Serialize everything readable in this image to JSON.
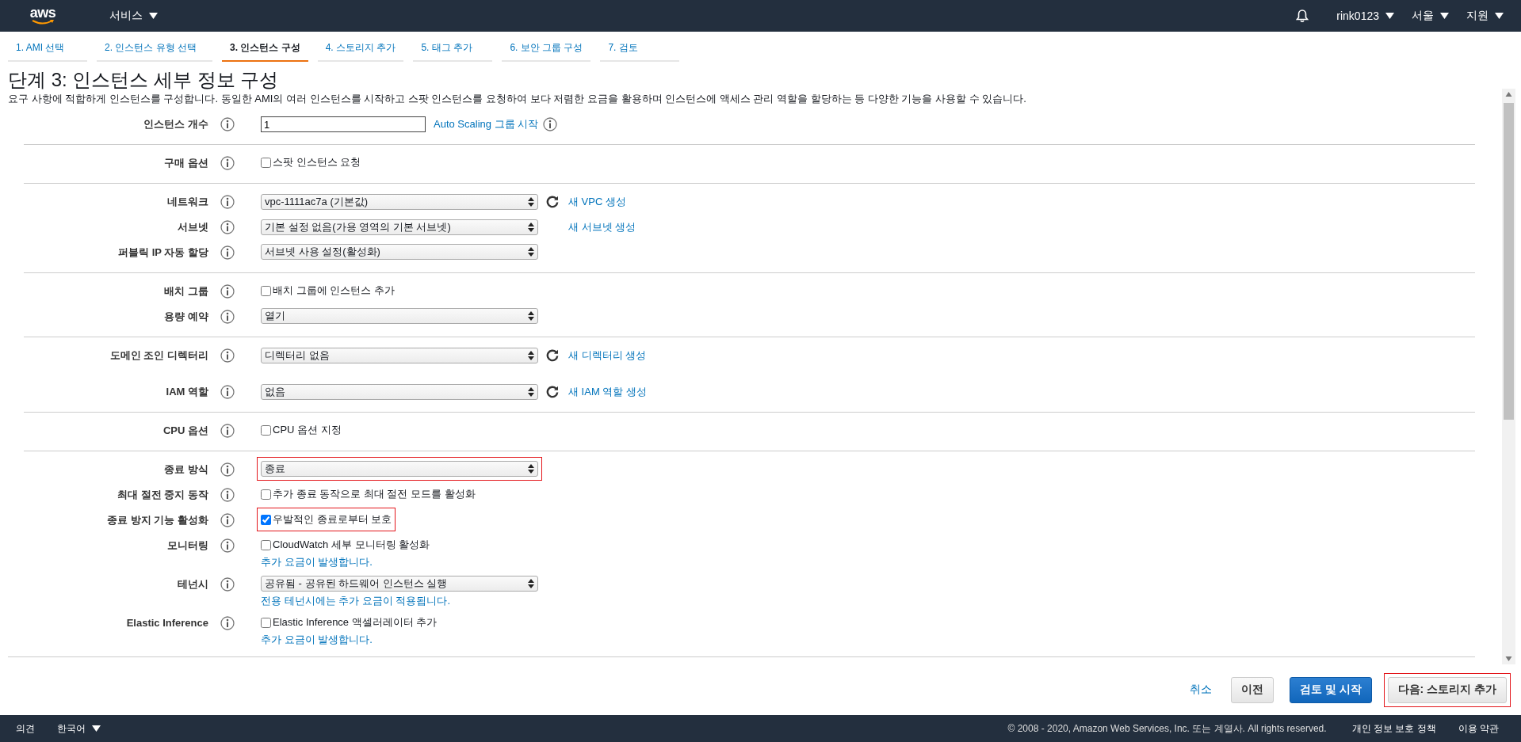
{
  "topbar": {
    "logo": "aws",
    "services": "서비스",
    "user": "rink0123",
    "region": "서울",
    "support": "지원"
  },
  "tabs": [
    {
      "label": "1. AMI 선택",
      "selected": false
    },
    {
      "label": "2. 인스턴스 유형 선택",
      "selected": false
    },
    {
      "label": "3. 인스턴스 구성",
      "selected": true
    },
    {
      "label": "4. 스토리지 추가",
      "selected": false
    },
    {
      "label": "5. 태그 추가",
      "selected": false
    },
    {
      "label": "6. 보안 그룹 구성",
      "selected": false
    },
    {
      "label": "7. 검토",
      "selected": false
    }
  ],
  "title": "단계 3: 인스턴스 세부 정보 구성",
  "description": "요구 사항에 적합하게 인스턴스를 구성합니다. 동일한 AMI의 여러 인스턴스를 시작하고 스팟 인스턴스를 요청하여 보다 저렴한 요금을 활용하며 인스턴스에 액세스 관리 역할을 할당하는 등 다양한 기능을 사용할 수 있습니다.",
  "sections": [
    {
      "rows": [
        {
          "label": "인스턴스 개수",
          "control": {
            "kind": "text",
            "value": "1"
          },
          "link": {
            "text": "Auto Scaling 그룹 시작",
            "refresh": false,
            "info": true
          }
        }
      ]
    },
    {
      "rows": [
        {
          "label": "구매 옵션",
          "control": {
            "kind": "checkbox",
            "text": "스팟 인스턴스 요청",
            "checked": false
          }
        }
      ]
    },
    {
      "rows": [
        {
          "label": "네트워크",
          "control": {
            "kind": "select",
            "value": "vpc-1111ac7a (기본값)"
          },
          "link": {
            "text": "새 VPC 생성",
            "refresh": true,
            "info": false
          }
        },
        {
          "label": "서브넷",
          "control": {
            "kind": "select",
            "value": "기본 설정 없음(가용 영역의 기본 서브넷)"
          },
          "link": {
            "text": "새 서브넷 생성",
            "refresh": false,
            "info": false
          }
        },
        {
          "label": "퍼블릭 IP 자동 할당",
          "control": {
            "kind": "select",
            "value": "서브넷 사용 설정(활성화)"
          }
        }
      ]
    },
    {
      "rows": [
        {
          "label": "배치 그룹",
          "control": {
            "kind": "checkbox",
            "text": "배치 그룹에 인스턴스 추가",
            "checked": false
          }
        },
        {
          "label": "용량 예약",
          "control": {
            "kind": "select",
            "value": "열기"
          }
        }
      ]
    },
    {
      "rows": [
        {
          "label": "도메인 조인 디렉터리",
          "control": {
            "kind": "select",
            "value": "디렉터리 없음"
          },
          "link": {
            "text": "새 디렉터리 생성",
            "refresh": true,
            "info": false
          }
        },
        {
          "label": "IAM 역할",
          "control": {
            "kind": "select",
            "value": "없음"
          },
          "link": {
            "text": "새 IAM 역할 생성",
            "refresh": true,
            "info": false
          }
        }
      ]
    },
    {
      "rows": [
        {
          "label": "CPU 옵션",
          "control": {
            "kind": "checkbox",
            "text": "CPU 옵션 지정",
            "checked": false
          }
        }
      ]
    },
    {
      "rows": [
        {
          "label": "종료 방식",
          "control": {
            "kind": "select",
            "value": "종료",
            "highlighted": true
          }
        },
        {
          "label": "최대 절전 중지 동작",
          "control": {
            "kind": "checkbox",
            "text": "추가 종료 동작으로 최대 절전 모드를 활성화",
            "checked": false
          }
        },
        {
          "label": "종료 방지 기능 활성화",
          "control": {
            "kind": "checkbox",
            "text": "우발적인 종료로부터 보호",
            "checked": true,
            "highlighted": true
          }
        },
        {
          "label": "모니터링",
          "control": {
            "kind": "checkbox",
            "text": "CloudWatch 세부 모니터링 활성화",
            "checked": false
          },
          "note": "추가 요금이 발생합니다."
        },
        {
          "label": "테넌시",
          "control": {
            "kind": "select",
            "value": "공유됨 - 공유된 하드웨어 인스턴스 실행"
          },
          "note": "전용 테넌시에는 추가 요금이 적용됩니다."
        },
        {
          "label": "Elastic Inference",
          "control": {
            "kind": "checkbox",
            "text": "Elastic Inference 액셀러레이터 추가",
            "checked": false
          },
          "note": "추가 요금이 발생합니다."
        }
      ]
    }
  ],
  "buttons": [
    {
      "kind": "link",
      "label": "취소"
    },
    {
      "kind": "default",
      "label": "이전"
    },
    {
      "kind": "primary",
      "label": "검토 및 시작"
    },
    {
      "kind": "default",
      "label": "다음: 스토리지 추가",
      "highlighted": true
    }
  ],
  "footer": {
    "feedback": "의견",
    "language": "한국어",
    "copyright": "© 2008 - 2020, Amazon Web Services, Inc. 또는 계열사. All rights reserved.",
    "links": [
      "개인 정보 보호 정책",
      "이용 약관"
    ]
  }
}
